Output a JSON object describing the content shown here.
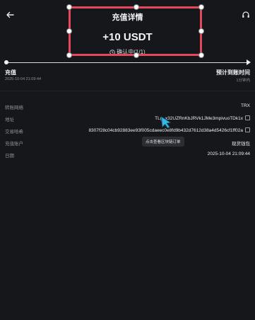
{
  "header": {
    "title": "充值详情"
  },
  "summary": {
    "amount": "+10 USDT",
    "status": "确认中(1/1)"
  },
  "timeline": {
    "start_label": "充值",
    "start_time": "2025-10-04 21:09:44",
    "end_label": "预计到账时间",
    "end_sub": "1分钟内"
  },
  "details": [
    {
      "label": "转账网络",
      "value": "TRX"
    },
    {
      "label": "地址",
      "value": "TLg  x32UZRnKbJRVk1JMe3mpivuoTDk1x"
    },
    {
      "label": "交易哈希",
      "value": "8307f28c04cb92883ee93f005cdaeec0e8fd9b432d7612d38a4d5426cf1ff02a"
    },
    {
      "label": "充值账户",
      "value": "现货钱包"
    },
    {
      "label": "日期",
      "value": "2025-10-04 21:09:44"
    }
  ],
  "tooltip": {
    "text": "点击查看区块链订单"
  },
  "icons": {
    "back": "back-arrow-icon",
    "support": "headset-icon",
    "status": "clock-icon",
    "copy": "copy-icon"
  },
  "colors": {
    "background": "#16171b",
    "selection": "#e5485a"
  }
}
